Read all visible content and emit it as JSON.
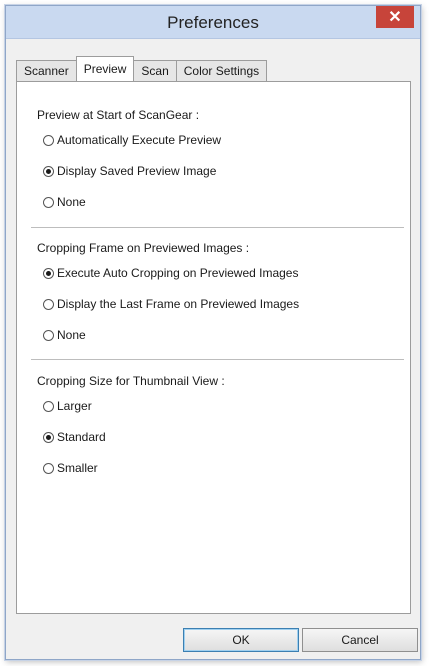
{
  "window": {
    "title": "Preferences",
    "close_glyph": "✕"
  },
  "tabs": [
    {
      "label": "Scanner",
      "active": false
    },
    {
      "label": "Preview",
      "active": true
    },
    {
      "label": "Scan",
      "active": false
    },
    {
      "label": "Color Settings",
      "active": false
    }
  ],
  "preview_start": {
    "title": "Preview at Start of ScanGear :",
    "options": [
      {
        "label": "Automatically Execute Preview",
        "checked": false
      },
      {
        "label": "Display Saved Preview Image",
        "checked": true
      },
      {
        "label": "None",
        "checked": false
      }
    ]
  },
  "cropping_frame": {
    "title": "Cropping Frame on Previewed Images :",
    "options": [
      {
        "label": "Execute Auto Cropping on Previewed Images",
        "checked": true
      },
      {
        "label": "Display the Last Frame on Previewed Images",
        "checked": false
      },
      {
        "label": "None",
        "checked": false
      }
    ]
  },
  "cropping_size": {
    "title": "Cropping Size for Thumbnail View :",
    "options": [
      {
        "label": "Larger",
        "checked": false
      },
      {
        "label": "Standard",
        "checked": true
      },
      {
        "label": "Smaller",
        "checked": false
      }
    ]
  },
  "buttons": {
    "ok": "OK",
    "cancel": "Cancel"
  },
  "colors": {
    "titlebar": "#c9d9f0",
    "close": "#c7443a"
  }
}
